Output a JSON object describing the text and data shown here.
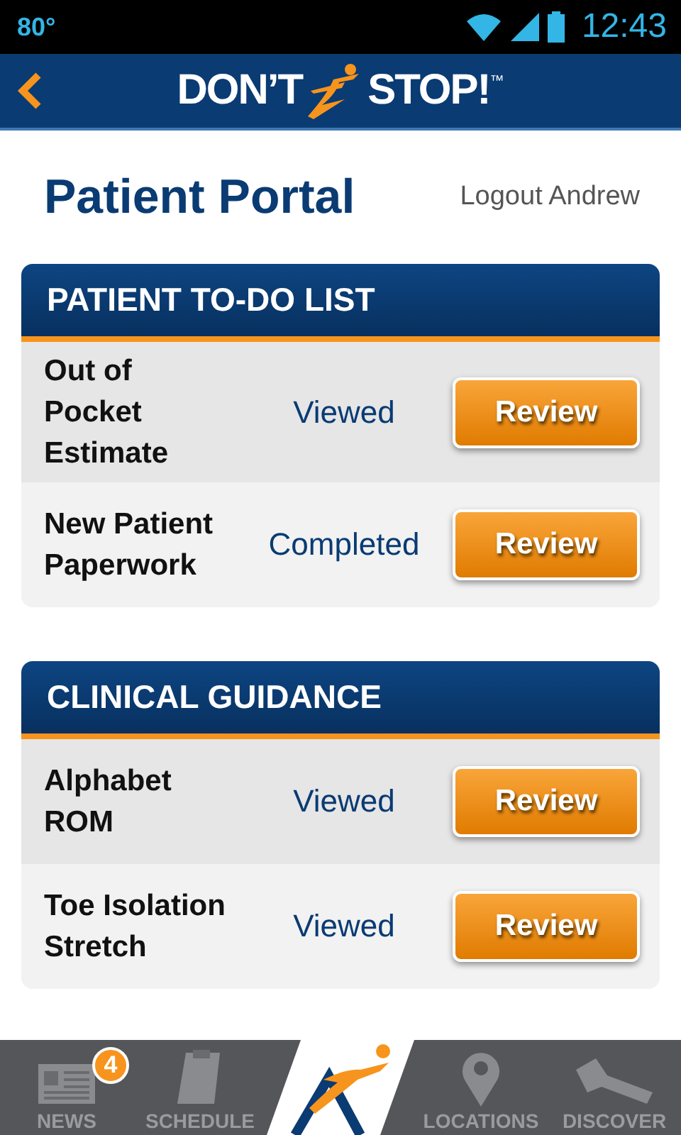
{
  "status_bar": {
    "temperature": "80°",
    "time": "12:43"
  },
  "header": {
    "logo_left": "DON’T",
    "logo_right": "STOP!",
    "trademark": "™"
  },
  "page": {
    "title": "Patient Portal",
    "logout": "Logout Andrew"
  },
  "sections": [
    {
      "title": "PATIENT TO-DO LIST",
      "rows": [
        {
          "name": "Out of Pocket Estimate",
          "status": "Viewed",
          "action": "Review"
        },
        {
          "name": "New Patient Paperwork",
          "status": "Completed",
          "action": "Review"
        }
      ]
    },
    {
      "title": "CLINICAL GUIDANCE",
      "rows": [
        {
          "name": "Alphabet ROM",
          "status": "Viewed",
          "action": "Review"
        },
        {
          "name": "Toe Isolation Stretch",
          "status": "Viewed",
          "action": "Review"
        }
      ]
    }
  ],
  "nav_items": [
    {
      "kind": "news",
      "label": "NEWS",
      "badge": "4"
    },
    {
      "kind": "schedule",
      "label": "SCHEDULE"
    },
    {
      "kind": "home"
    },
    {
      "kind": "locations",
      "label": "LOCATIONS"
    },
    {
      "kind": "discover",
      "label": "DISCOVER"
    }
  ]
}
